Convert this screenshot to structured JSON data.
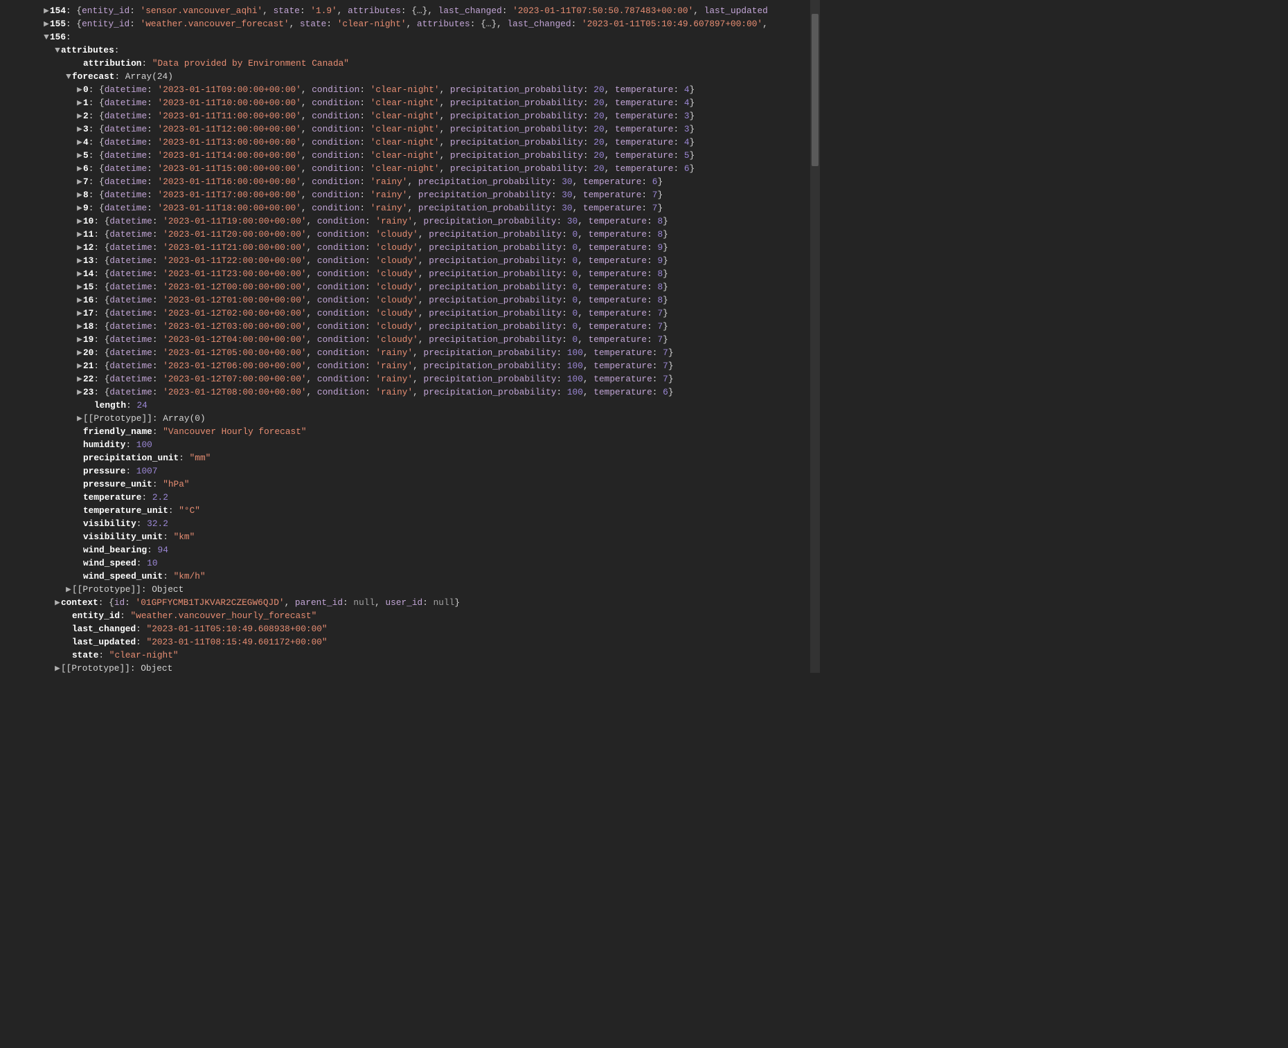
{
  "collapsed_rows": [
    {
      "index": "154",
      "entity_id": "sensor.vancouver_aqhi",
      "state": "1.9",
      "attributes_summary": "{…}",
      "last_changed": "2023-01-11T07:50:50.787483+00:00",
      "trailing_key": "last_updated"
    },
    {
      "index": "155",
      "entity_id": "weather.vancouver_forecast",
      "state": "clear-night",
      "attributes_summary": "{…}",
      "last_changed": "2023-01-11T05:10:49.607897+00:00",
      "trailing_comma": true
    }
  ],
  "expanded_index": "156",
  "attributes_label": "attributes",
  "attribution": {
    "key": "attribution",
    "value": "\"Data provided by Environment Canada\""
  },
  "forecast_label": "forecast",
  "forecast_type": "Array(24)",
  "forecast": [
    {
      "idx": "0",
      "datetime": "2023-01-11T09:00:00+00:00",
      "condition": "clear-night",
      "precip": 20,
      "temp": 4
    },
    {
      "idx": "1",
      "datetime": "2023-01-11T10:00:00+00:00",
      "condition": "clear-night",
      "precip": 20,
      "temp": 4
    },
    {
      "idx": "2",
      "datetime": "2023-01-11T11:00:00+00:00",
      "condition": "clear-night",
      "precip": 20,
      "temp": 3
    },
    {
      "idx": "3",
      "datetime": "2023-01-11T12:00:00+00:00",
      "condition": "clear-night",
      "precip": 20,
      "temp": 3
    },
    {
      "idx": "4",
      "datetime": "2023-01-11T13:00:00+00:00",
      "condition": "clear-night",
      "precip": 20,
      "temp": 4
    },
    {
      "idx": "5",
      "datetime": "2023-01-11T14:00:00+00:00",
      "condition": "clear-night",
      "precip": 20,
      "temp": 5
    },
    {
      "idx": "6",
      "datetime": "2023-01-11T15:00:00+00:00",
      "condition": "clear-night",
      "precip": 20,
      "temp": 6
    },
    {
      "idx": "7",
      "datetime": "2023-01-11T16:00:00+00:00",
      "condition": "rainy",
      "precip": 30,
      "temp": 6
    },
    {
      "idx": "8",
      "datetime": "2023-01-11T17:00:00+00:00",
      "condition": "rainy",
      "precip": 30,
      "temp": 7
    },
    {
      "idx": "9",
      "datetime": "2023-01-11T18:00:00+00:00",
      "condition": "rainy",
      "precip": 30,
      "temp": 7
    },
    {
      "idx": "10",
      "datetime": "2023-01-11T19:00:00+00:00",
      "condition": "rainy",
      "precip": 30,
      "temp": 8
    },
    {
      "idx": "11",
      "datetime": "2023-01-11T20:00:00+00:00",
      "condition": "cloudy",
      "precip": 0,
      "temp": 8
    },
    {
      "idx": "12",
      "datetime": "2023-01-11T21:00:00+00:00",
      "condition": "cloudy",
      "precip": 0,
      "temp": 9
    },
    {
      "idx": "13",
      "datetime": "2023-01-11T22:00:00+00:00",
      "condition": "cloudy",
      "precip": 0,
      "temp": 9
    },
    {
      "idx": "14",
      "datetime": "2023-01-11T23:00:00+00:00",
      "condition": "cloudy",
      "precip": 0,
      "temp": 8
    },
    {
      "idx": "15",
      "datetime": "2023-01-12T00:00:00+00:00",
      "condition": "cloudy",
      "precip": 0,
      "temp": 8
    },
    {
      "idx": "16",
      "datetime": "2023-01-12T01:00:00+00:00",
      "condition": "cloudy",
      "precip": 0,
      "temp": 8
    },
    {
      "idx": "17",
      "datetime": "2023-01-12T02:00:00+00:00",
      "condition": "cloudy",
      "precip": 0,
      "temp": 7
    },
    {
      "idx": "18",
      "datetime": "2023-01-12T03:00:00+00:00",
      "condition": "cloudy",
      "precip": 0,
      "temp": 7
    },
    {
      "idx": "19",
      "datetime": "2023-01-12T04:00:00+00:00",
      "condition": "cloudy",
      "precip": 0,
      "temp": 7
    },
    {
      "idx": "20",
      "datetime": "2023-01-12T05:00:00+00:00",
      "condition": "rainy",
      "precip": 100,
      "temp": 7
    },
    {
      "idx": "21",
      "datetime": "2023-01-12T06:00:00+00:00",
      "condition": "rainy",
      "precip": 100,
      "temp": 7
    },
    {
      "idx": "22",
      "datetime": "2023-01-12T07:00:00+00:00",
      "condition": "rainy",
      "precip": 100,
      "temp": 7
    },
    {
      "idx": "23",
      "datetime": "2023-01-12T08:00:00+00:00",
      "condition": "rainy",
      "precip": 100,
      "temp": 6
    }
  ],
  "forecast_length": {
    "key": "length",
    "value": 24
  },
  "forecast_proto": {
    "label": "[[Prototype]]",
    "value": "Array(0)"
  },
  "attr_props": [
    {
      "key": "friendly_name",
      "value": "\"Vancouver Hourly forecast\"",
      "type": "str"
    },
    {
      "key": "humidity",
      "value": 100,
      "type": "num"
    },
    {
      "key": "precipitation_unit",
      "value": "\"mm\"",
      "type": "str"
    },
    {
      "key": "pressure",
      "value": 1007,
      "type": "num"
    },
    {
      "key": "pressure_unit",
      "value": "\"hPa\"",
      "type": "str"
    },
    {
      "key": "temperature",
      "value": 2.2,
      "type": "num"
    },
    {
      "key": "temperature_unit",
      "value": "\"°C\"",
      "type": "str"
    },
    {
      "key": "visibility",
      "value": 32.2,
      "type": "num"
    },
    {
      "key": "visibility_unit",
      "value": "\"km\"",
      "type": "str"
    },
    {
      "key": "wind_bearing",
      "value": 94,
      "type": "num"
    },
    {
      "key": "wind_speed",
      "value": 10,
      "type": "num"
    },
    {
      "key": "wind_speed_unit",
      "value": "\"km/h\"",
      "type": "str"
    }
  ],
  "attr_proto": {
    "label": "[[Prototype]]",
    "value": "Object"
  },
  "context_row": {
    "key": "context",
    "id": "01GPFYCMB1TJKVAR2CZEGW6QJD",
    "parent_id": "null",
    "user_id": "null"
  },
  "tail_props": [
    {
      "key": "entity_id",
      "value": "\"weather.vancouver_hourly_forecast\""
    },
    {
      "key": "last_changed",
      "value": "\"2023-01-11T05:10:49.608938+00:00\""
    },
    {
      "key": "last_updated",
      "value": "\"2023-01-11T08:15:49.601172+00:00\""
    },
    {
      "key": "state",
      "value": "\"clear-night\""
    }
  ],
  "tail_proto": {
    "label": "[[Prototype]]",
    "value": "Object"
  },
  "labels": {
    "entity_id": "entity_id",
    "state": "state",
    "attributes": "attributes",
    "last_changed": "last_changed",
    "datetime": "datetime",
    "condition": "condition",
    "precip": "precipitation_probability",
    "temperature": "temperature",
    "id": "id",
    "parent_id": "parent_id",
    "user_id": "user_id"
  }
}
